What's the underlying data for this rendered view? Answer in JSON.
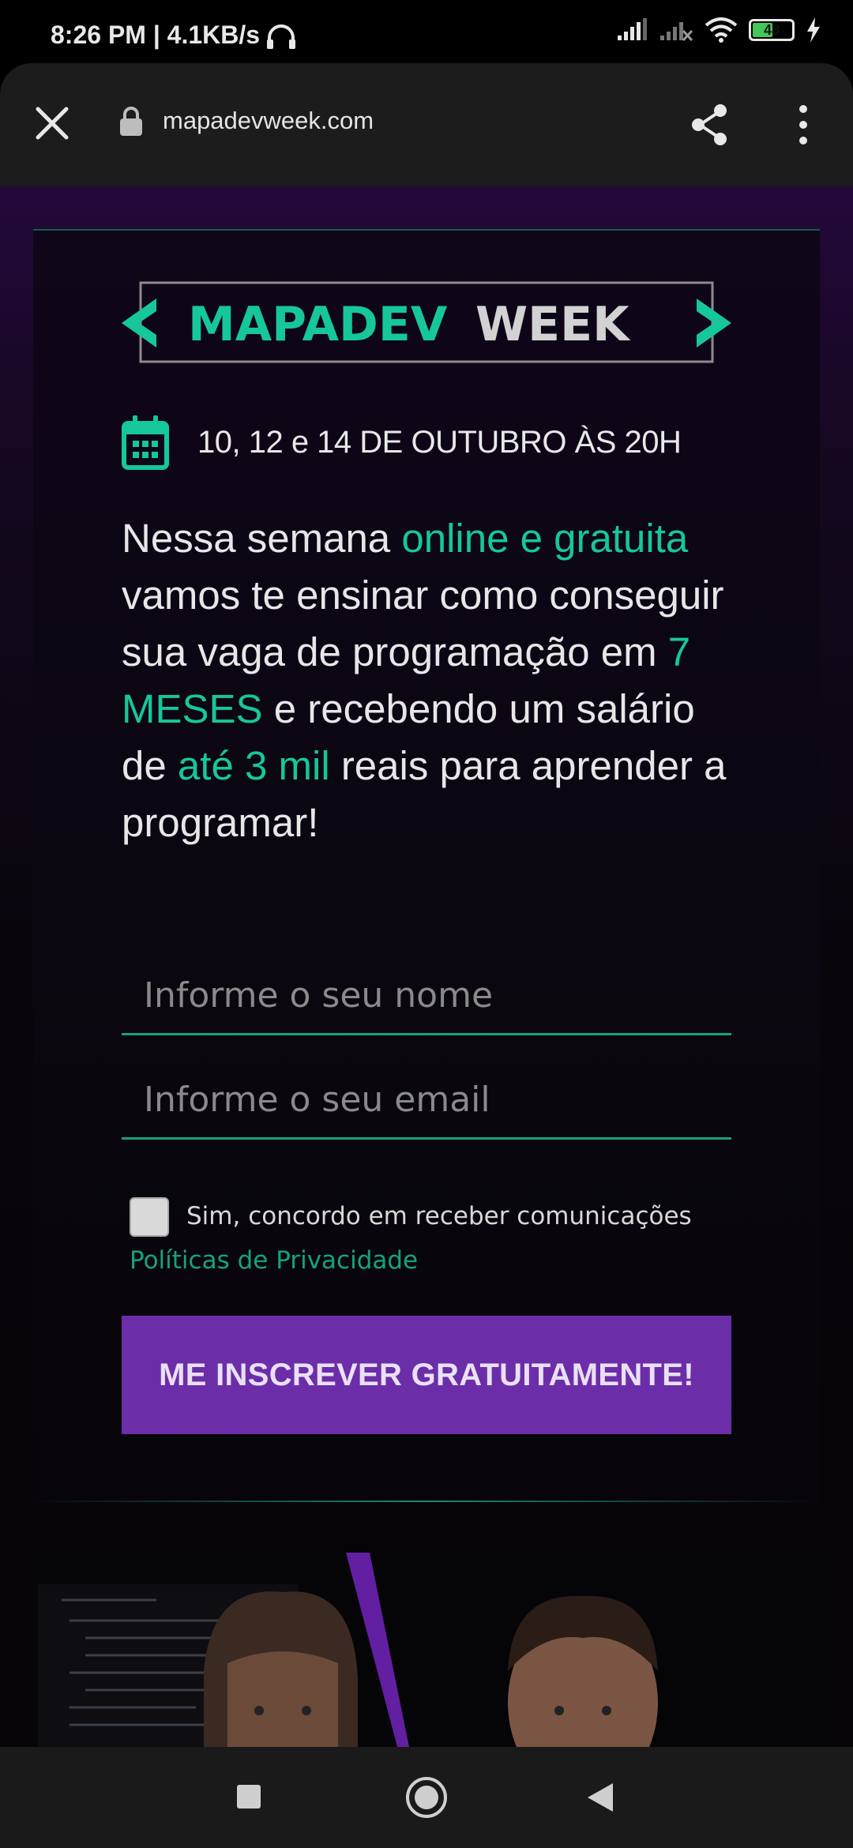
{
  "status_bar": {
    "time_and_speed": "8:26 PM | 4.1KB/s",
    "battery": "48"
  },
  "browser": {
    "url": "mapadevweek.com"
  },
  "page": {
    "logo": {
      "word1": "MAPADEV",
      "word2": "WEEK"
    },
    "date_text": "10, 12 e 14 DE OUTUBRO ÀS 20H",
    "description": [
      {
        "text": "Nessa semana ",
        "highlight": false
      },
      {
        "text": "online e gratuita",
        "highlight": true
      },
      {
        "text": " vamos te ensinar como conseguir sua vaga de programação em ",
        "highlight": false
      },
      {
        "text": "7 MESES",
        "highlight": true
      },
      {
        "text": " e recebendo um salário de ",
        "highlight": false
      },
      {
        "text": "até 3 mil",
        "highlight": true
      },
      {
        "text": " reais para aprender a programar!",
        "highlight": false
      }
    ],
    "form": {
      "name_placeholder": "Informe o seu nome",
      "email_placeholder": "Informe o seu email",
      "consent_label": "Sim, concordo em receber comunicações",
      "privacy_link": "Políticas de Privacidade",
      "submit_label": "ME INSCREVER GRATUITAMENTE!"
    }
  },
  "colors": {
    "accent_green": "#16c79a",
    "button_purple": "#6b2ea8",
    "background_purple": "#1a0a2b"
  }
}
